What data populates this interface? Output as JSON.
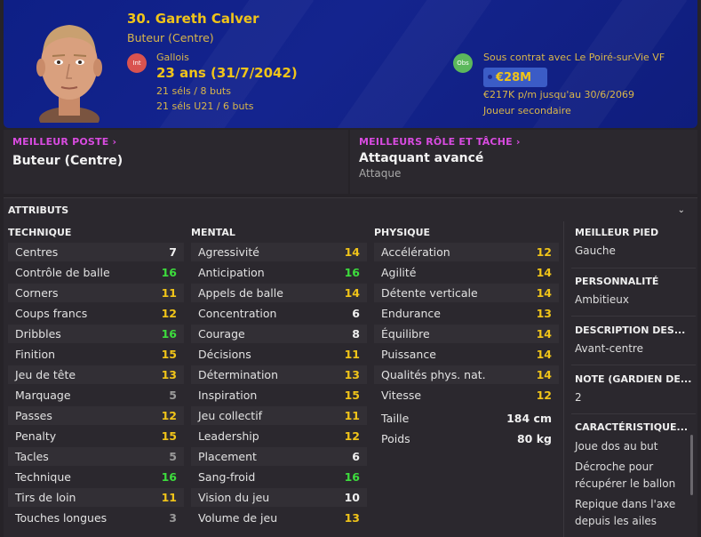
{
  "player": {
    "name": "30. Gareth Calver",
    "position": "Buteur (Centre)",
    "int_badge": "Int",
    "nationality": "Gallois",
    "age": "23 ans (31/7/2042)",
    "caps": "21 séls / 8 buts",
    "caps_u21": "21 séls U21 / 6 buts",
    "obs_badge": "Obs",
    "contract": "Sous contrat avec Le Poiré-sur-Vie VF",
    "value": "€28M",
    "wage": "€217K p/m jusqu'au 30/6/2069",
    "squad_role": "Joueur secondaire"
  },
  "best_position": {
    "label": "MEILLEUR POSTE",
    "value": "Buteur (Centre)"
  },
  "best_role": {
    "label": "MEILLEURS RÔLE ET TÂCHE",
    "value": "Attaquant avancé",
    "duty": "Attaque"
  },
  "attributes": {
    "title": "ATTRIBUTS",
    "technique": {
      "header": "TECHNIQUE",
      "rows": [
        {
          "name": "Centres",
          "value": "7",
          "color": "w"
        },
        {
          "name": "Contrôle de balle",
          "value": "16",
          "color": "g"
        },
        {
          "name": "Corners",
          "value": "11",
          "color": "y"
        },
        {
          "name": "Coups francs",
          "value": "12",
          "color": "y"
        },
        {
          "name": "Dribbles",
          "value": "16",
          "color": "g"
        },
        {
          "name": "Finition",
          "value": "15",
          "color": "y"
        },
        {
          "name": "Jeu de tête",
          "value": "13",
          "color": "y"
        },
        {
          "name": "Marquage",
          "value": "5",
          "color": "gr"
        },
        {
          "name": "Passes",
          "value": "12",
          "color": "y"
        },
        {
          "name": "Penalty",
          "value": "15",
          "color": "y"
        },
        {
          "name": "Tacles",
          "value": "5",
          "color": "gr"
        },
        {
          "name": "Technique",
          "value": "16",
          "color": "g"
        },
        {
          "name": "Tirs de loin",
          "value": "11",
          "color": "y"
        },
        {
          "name": "Touches longues",
          "value": "3",
          "color": "gr"
        }
      ]
    },
    "mental": {
      "header": "MENTAL",
      "rows": [
        {
          "name": "Agressivité",
          "value": "14",
          "color": "y"
        },
        {
          "name": "Anticipation",
          "value": "16",
          "color": "g"
        },
        {
          "name": "Appels de balle",
          "value": "14",
          "color": "y"
        },
        {
          "name": "Concentration",
          "value": "6",
          "color": "w"
        },
        {
          "name": "Courage",
          "value": "8",
          "color": "w"
        },
        {
          "name": "Décisions",
          "value": "11",
          "color": "y"
        },
        {
          "name": "Détermination",
          "value": "13",
          "color": "y"
        },
        {
          "name": "Inspiration",
          "value": "15",
          "color": "y"
        },
        {
          "name": "Jeu collectif",
          "value": "11",
          "color": "y"
        },
        {
          "name": "Leadership",
          "value": "12",
          "color": "y"
        },
        {
          "name": "Placement",
          "value": "6",
          "color": "w"
        },
        {
          "name": "Sang-froid",
          "value": "16",
          "color": "g"
        },
        {
          "name": "Vision du jeu",
          "value": "10",
          "color": "w"
        },
        {
          "name": "Volume de jeu",
          "value": "13",
          "color": "y"
        }
      ]
    },
    "physique": {
      "header": "PHYSIQUE",
      "rows": [
        {
          "name": "Accélération",
          "value": "12",
          "color": "y"
        },
        {
          "name": "Agilité",
          "value": "14",
          "color": "y"
        },
        {
          "name": "Détente verticale",
          "value": "14",
          "color": "y"
        },
        {
          "name": "Endurance",
          "value": "13",
          "color": "y"
        },
        {
          "name": "Équilibre",
          "value": "14",
          "color": "y"
        },
        {
          "name": "Puissance",
          "value": "14",
          "color": "y"
        },
        {
          "name": "Qualités phys. nat.",
          "value": "14",
          "color": "y"
        },
        {
          "name": "Vitesse",
          "value": "12",
          "color": "y"
        }
      ],
      "height_label": "Taille",
      "height": "184 cm",
      "weight_label": "Poids",
      "weight": "80 kg"
    }
  },
  "sidebar": {
    "foot_label": "MEILLEUR PIED",
    "foot": "Gauche",
    "personality_label": "PERSONNALITÉ",
    "personality": "Ambitieux",
    "description_label": "DESCRIPTION DES...",
    "description": "Avant-centre",
    "gk_label": "NOTE (GARDIEN DE...",
    "gk": "2",
    "traits_label": "CARACTÉRISTIQUE...",
    "traits": [
      "Joue dos au but",
      "Décroche pour",
      "récupérer le ballon",
      "Repique dans l'axe",
      "depuis les ailes"
    ]
  },
  "colors": {
    "header_bg": "#14248e",
    "gold": "#f0c419",
    "green": "#3ddc3d",
    "magenta": "#d84be0"
  }
}
